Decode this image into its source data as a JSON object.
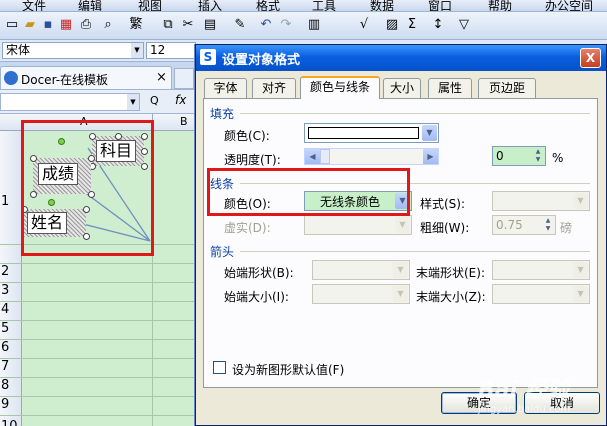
{
  "app": {
    "menu": [
      "文件",
      "编辑",
      "视图",
      "插入",
      "格式",
      "工具",
      "数据",
      "窗口",
      "帮助",
      "办公空间"
    ],
    "font_name": "宋体",
    "font_size": "12",
    "doc_tab": "Docer-在线模板",
    "doc_tab_close": "×",
    "fx_label": "fx",
    "zoom_label": "Q"
  },
  "sheet": {
    "columns": [
      "A",
      "B"
    ],
    "rows": [
      "1",
      "2",
      "3",
      "4",
      "5",
      "6",
      "7",
      "8",
      "9",
      "10"
    ],
    "shapes": [
      "科目",
      "成绩",
      "姓名"
    ]
  },
  "dialog": {
    "title": "设置对象格式",
    "close_glyph": "X",
    "tabs": [
      "字体",
      "对齐",
      "颜色与线条",
      "大小",
      "属性",
      "页边距"
    ],
    "active_tab": "颜色与线条",
    "fill": {
      "section": "填充",
      "color_label": "颜色(C):",
      "transparency_label": "透明度(T):",
      "transparency_value": "0",
      "transparency_unit": "%",
      "transparency_level": 0
    },
    "line": {
      "section": "线条",
      "color_label": "颜色(O):",
      "color_value": "无线条颜色",
      "style_label": "样式(S):",
      "dash_label": "虚实(D):",
      "weight_label": "粗细(W):",
      "weight_value": "0.75",
      "weight_unit": "磅"
    },
    "arrows": {
      "section": "箭头",
      "begin_style_label": "始端形状(B):",
      "end_style_label": "末端形状(E):",
      "begin_size_label": "始端大小(I):",
      "end_size_label": "末端大小(Z):"
    },
    "default_checkbox_label": "设为新图形默认值(F)",
    "ok_label": "确定",
    "cancel_label": "取消"
  },
  "watermark": "Bai 经验",
  "watermark_sub": "jingyan.baidu.com",
  "colors": {
    "highlight_red": "#e01818",
    "titlebar_blue": "#0a5fe0",
    "sheet_green": "#cfeecf",
    "line_color_combo_bg": "#c8f0c8"
  }
}
